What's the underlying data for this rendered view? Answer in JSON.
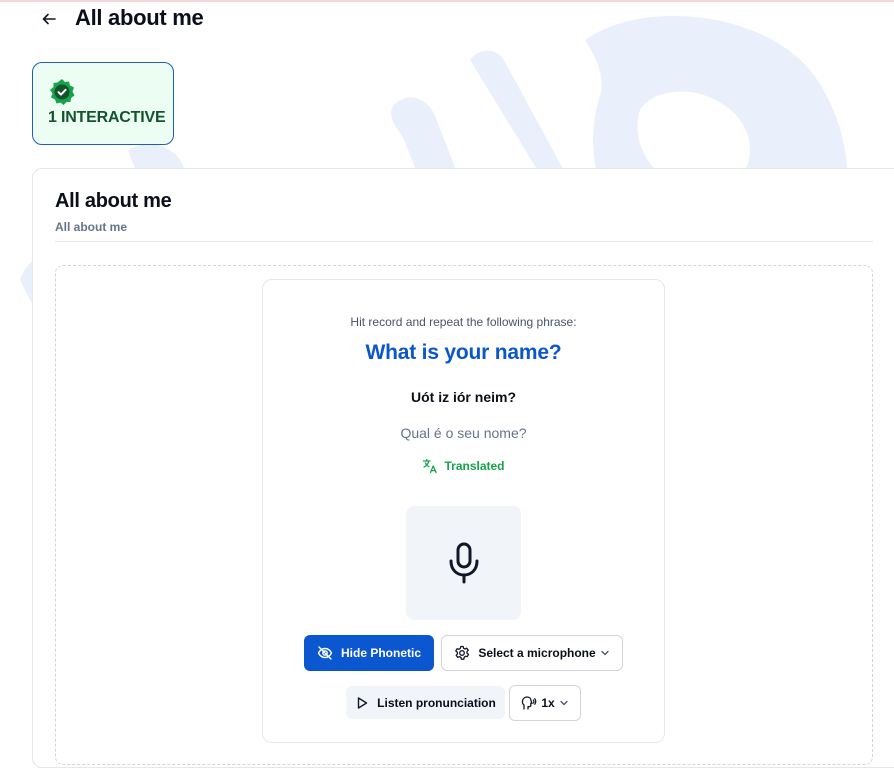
{
  "header": {
    "back_icon": "arrow-left-icon",
    "title": "All about me"
  },
  "badge": {
    "icon": "verified-check-badge-icon",
    "label": "1 INTERACTIVE",
    "color": "#14532d",
    "background": "#ecfdf3",
    "border": "#1f5fb8"
  },
  "card": {
    "title": "All about me",
    "subtitle": "All about me"
  },
  "exercise": {
    "instruction": "Hit record and repeat the following phrase:",
    "phrase": "What is your name?",
    "phonetic": "Uót iz iór neim?",
    "translation": "Qual é o seu nome?",
    "translated_label": "Translated",
    "translated_icon": "translate-icon",
    "mic_icon": "microphone-icon",
    "buttons": {
      "hide_phonetic": "Hide Phonetic",
      "hide_phonetic_icon": "eye-off-icon",
      "select_microphone": "Select a microphone",
      "select_microphone_icon": "gear-icon",
      "listen": "Listen pronunciation",
      "listen_icon": "play-icon",
      "speed": "1x",
      "speed_icon": "speaker-head-icon"
    }
  },
  "colors": {
    "accent": "#0b57d0",
    "phrase": "#0b57c9",
    "success": "#16a34a",
    "muted": "#64748b"
  }
}
